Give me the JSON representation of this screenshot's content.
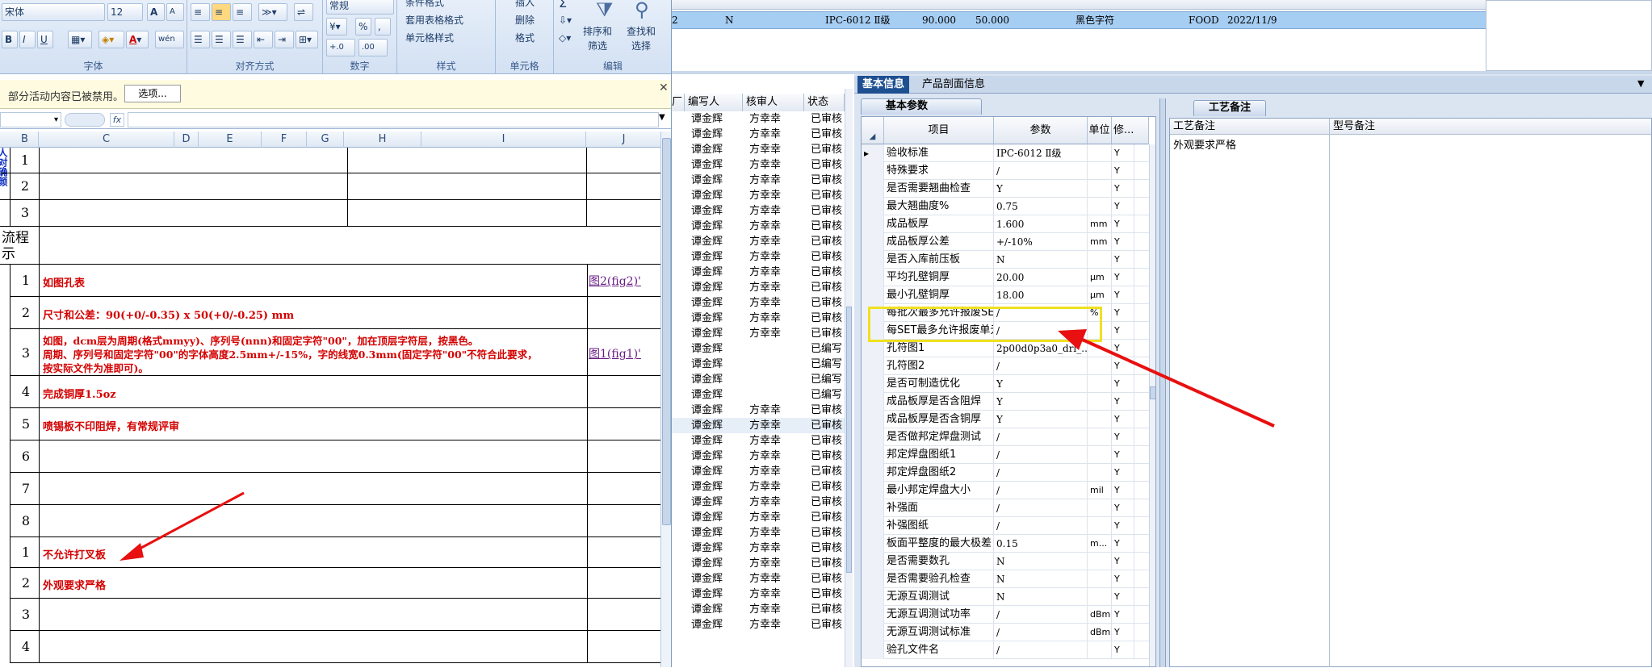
{
  "ribbon": {
    "font_name": "宋体",
    "font_size": "12",
    "bold": "B",
    "italic": "I",
    "underline": "U",
    "font_color_glyph": "A",
    "grow_font": "A",
    "shrink_font": "A",
    "wen": "wén",
    "group_font": "字体",
    "group_align": "对齐方式",
    "group_number": "数字",
    "number_format": "常规",
    "percent": "%",
    "comma": ",",
    "inc_decimal": "+.0",
    "dec_decimal": ".00",
    "group_style": "样式",
    "conditional_format": "条件格式",
    "table_format": "套用表格格式",
    "cell_style": "单元格样式",
    "group_cells": "单元格",
    "insert": "插入",
    "delete": "删除",
    "format": "格式",
    "group_edit": "编辑",
    "sigma": "Σ",
    "sort_filter_1": "排序和",
    "sort_filter_2": "筛选",
    "find_select_1": "查找和",
    "find_select_2": "选择"
  },
  "message_bar": {
    "text": "部分活动内容已被禁用。",
    "options_button": "选项..."
  },
  "formula_bar": {
    "fx": "fx",
    "value": ""
  },
  "sheet": {
    "columns": [
      "B",
      "C",
      "D",
      "E",
      "F",
      "G",
      "H",
      "I",
      "J"
    ],
    "top_rows": [
      {
        "num": "1"
      },
      {
        "num": "2"
      },
      {
        "num": "3"
      }
    ],
    "side_vertical_text": "人对确颜",
    "process_label_1": "流程",
    "process_label_2": "示",
    "rows": [
      {
        "num": "1",
        "text": "如图孔表",
        "link": "图2(fig2)'"
      },
      {
        "num": "2",
        "text": "尺寸和公差：90(+0/-0.35) x 50(+0/-0.25) mm",
        "link": ""
      },
      {
        "num": "3",
        "text": "如图，dcm层为周期(格式mmyy)、序列号(nnn)和固定字符\"00\"，加在顶层字符层，按黑色。",
        "text2": "周期、序列号和固定字符\"00\"的字体高度2.5mm+/-15%，字的线宽0.3mm(固定字符\"00\"不符合此要求，",
        "text3": "按实际文件为准即可)。",
        "link": "图1(fig1)'"
      },
      {
        "num": "4",
        "text": "完成铜厚1.5oz",
        "link": ""
      },
      {
        "num": "5",
        "text": "喷锡板不印阻焊，有常规评审",
        "link": ""
      },
      {
        "num": "6",
        "text": "",
        "link": ""
      },
      {
        "num": "7",
        "text": "",
        "link": ""
      },
      {
        "num": "8",
        "text": "",
        "link": ""
      },
      {
        "num": "1",
        "text": "不允许打叉板",
        "link": ""
      },
      {
        "num": "2",
        "text": "外观要求严格",
        "link": ""
      },
      {
        "num": "3",
        "text": "",
        "link": ""
      },
      {
        "num": "4",
        "text": "",
        "link": ""
      }
    ]
  },
  "top_table": {
    "row": [
      "2",
      "N",
      "IPC-6012 Ⅱ级",
      "90.000",
      "50.000",
      "黑色字符",
      "FOOD",
      "2022/11/9"
    ]
  },
  "mid_list": {
    "headers": [
      "厂",
      "编写人",
      "核审人",
      "状态"
    ],
    "rows": [
      {
        "writer": "谭金辉",
        "auditor": "方幸幸",
        "status": "已审核"
      },
      {
        "writer": "谭金辉",
        "auditor": "方幸幸",
        "status": "已审核"
      },
      {
        "writer": "谭金辉",
        "auditor": "方幸幸",
        "status": "已审核"
      },
      {
        "writer": "谭金辉",
        "auditor": "方幸幸",
        "status": "已审核"
      },
      {
        "writer": "谭金辉",
        "auditor": "方幸幸",
        "status": "已审核"
      },
      {
        "writer": "谭金辉",
        "auditor": "方幸幸",
        "status": "已审核"
      },
      {
        "writer": "谭金辉",
        "auditor": "方幸幸",
        "status": "已审核"
      },
      {
        "writer": "谭金辉",
        "auditor": "方幸幸",
        "status": "已审核"
      },
      {
        "writer": "谭金辉",
        "auditor": "方幸幸",
        "status": "已审核"
      },
      {
        "writer": "谭金辉",
        "auditor": "方幸幸",
        "status": "已审核"
      },
      {
        "writer": "谭金辉",
        "auditor": "方幸幸",
        "status": "已审核"
      },
      {
        "writer": "谭金辉",
        "auditor": "方幸幸",
        "status": "已审核"
      },
      {
        "writer": "谭金辉",
        "auditor": "方幸幸",
        "status": "已审核"
      },
      {
        "writer": "谭金辉",
        "auditor": "方幸幸",
        "status": "已审核"
      },
      {
        "writer": "谭金辉",
        "auditor": "方幸幸",
        "status": "已审核"
      },
      {
        "writer": "谭金辉",
        "auditor": "",
        "status": "已编写"
      },
      {
        "writer": "谭金辉",
        "auditor": "",
        "status": "已编写"
      },
      {
        "writer": "谭金辉",
        "auditor": "",
        "status": "已编写"
      },
      {
        "writer": "谭金辉",
        "auditor": "",
        "status": "已编写"
      },
      {
        "writer": "谭金辉",
        "auditor": "方幸幸",
        "status": "已审核"
      },
      {
        "writer": "谭金辉",
        "auditor": "方幸幸",
        "status": "已审核"
      },
      {
        "writer": "谭金辉",
        "auditor": "方幸幸",
        "status": "已审核"
      },
      {
        "writer": "谭金辉",
        "auditor": "方幸幸",
        "status": "已审核"
      },
      {
        "writer": "谭金辉",
        "auditor": "方幸幸",
        "status": "已审核"
      },
      {
        "writer": "谭金辉",
        "auditor": "方幸幸",
        "status": "已审核"
      },
      {
        "writer": "谭金辉",
        "auditor": "方幸幸",
        "status": "已审核"
      },
      {
        "writer": "谭金辉",
        "auditor": "方幸幸",
        "status": "已审核"
      },
      {
        "writer": "谭金辉",
        "auditor": "方幸幸",
        "status": "已审核"
      },
      {
        "writer": "谭金辉",
        "auditor": "方幸幸",
        "status": "已审核"
      },
      {
        "writer": "谭金辉",
        "auditor": "方幸幸",
        "status": "已审核"
      },
      {
        "writer": "谭金辉",
        "auditor": "方幸幸",
        "status": "已审核"
      },
      {
        "writer": "谭金辉",
        "auditor": "方幸幸",
        "status": "已审核"
      },
      {
        "writer": "谭金辉",
        "auditor": "方幸幸",
        "status": "已审核"
      },
      {
        "writer": "谭金辉",
        "auditor": "方幸幸",
        "status": "已审核"
      }
    ]
  },
  "right_panel": {
    "tab_basic": "基本信息",
    "tab_section": "产品剖面信息",
    "param_tab": "基本参数",
    "craft_tab": "工艺备注",
    "grid_headers": [
      "项目",
      "参数",
      "单位",
      "修..."
    ],
    "craft_headers": [
      "工艺备注",
      "型号备注"
    ],
    "craft_value": "外观要求严格",
    "params": [
      {
        "name": "验收标准",
        "value": "IPC-6012 Ⅱ级",
        "unit": "",
        "mod": "Y"
      },
      {
        "name": "特殊要求",
        "value": "/",
        "unit": "",
        "mod": "Y"
      },
      {
        "name": "是否需要翘曲检查",
        "value": "Y",
        "unit": "",
        "mod": "Y"
      },
      {
        "name": "最大翘曲度%",
        "value": "0.75",
        "unit": "",
        "mod": "Y"
      },
      {
        "name": "成品板厚",
        "value": "1.600",
        "unit": "mm",
        "mod": "Y"
      },
      {
        "name": "成品板厚公差",
        "value": "+/-10%",
        "unit": "mm",
        "mod": "Y"
      },
      {
        "name": "是否入库前压板",
        "value": "N",
        "unit": "",
        "mod": "Y"
      },
      {
        "name": "平均孔壁铜厚",
        "value": "20.00",
        "unit": "μm",
        "mod": "Y"
      },
      {
        "name": "最小孔壁铜厚",
        "value": "18.00",
        "unit": "μm",
        "mod": "Y"
      },
      {
        "name": "每批次最多允许报废SET",
        "value": "/",
        "unit": "%",
        "mod": "Y"
      },
      {
        "name": "每SET最多允许报废单元",
        "value": "/",
        "unit": "",
        "mod": "Y"
      },
      {
        "name": "孔符图1",
        "value": "2p00d0p3a0_drl_...",
        "unit": "",
        "mod": "Y"
      },
      {
        "name": "孔符图2",
        "value": "/",
        "unit": "",
        "mod": "Y"
      },
      {
        "name": "是否可制造优化",
        "value": "Y",
        "unit": "",
        "mod": "Y"
      },
      {
        "name": "成品板厚是否含阻焊",
        "value": "Y",
        "unit": "",
        "mod": "Y"
      },
      {
        "name": "成品板厚是否含铜厚",
        "value": "Y",
        "unit": "",
        "mod": "Y"
      },
      {
        "name": "是否做邦定焊盘测试",
        "value": "/",
        "unit": "",
        "mod": "Y"
      },
      {
        "name": "邦定焊盘图纸1",
        "value": "/",
        "unit": "",
        "mod": "Y"
      },
      {
        "name": "邦定焊盘图纸2",
        "value": "/",
        "unit": "",
        "mod": "Y"
      },
      {
        "name": "最小邦定焊盘大小",
        "value": "/",
        "unit": "mil",
        "mod": "Y"
      },
      {
        "name": "补强面",
        "value": "/",
        "unit": "",
        "mod": "Y"
      },
      {
        "name": "补强图纸",
        "value": "/",
        "unit": "",
        "mod": "Y"
      },
      {
        "name": "板面平整度的最大极差",
        "value": "0.15",
        "unit": "m...",
        "mod": "Y"
      },
      {
        "name": "是否需要数孔",
        "value": "N",
        "unit": "",
        "mod": "Y"
      },
      {
        "name": "是否需要验孔检查",
        "value": "N",
        "unit": "",
        "mod": "Y"
      },
      {
        "name": "无源互调测试",
        "value": "N",
        "unit": "",
        "mod": "Y"
      },
      {
        "name": "无源互调测试功率",
        "value": "/",
        "unit": "dBm",
        "mod": "Y"
      },
      {
        "name": "无源互调测试标准",
        "value": "/",
        "unit": "dBm",
        "mod": "Y"
      },
      {
        "name": "验孔文件名",
        "value": "/",
        "unit": "",
        "mod": "Y"
      }
    ]
  },
  "colors": {
    "arrow": "#e81010",
    "highlight": "#f0e020",
    "selected_row": "#a6cdf2",
    "red_text": "#d40000"
  }
}
